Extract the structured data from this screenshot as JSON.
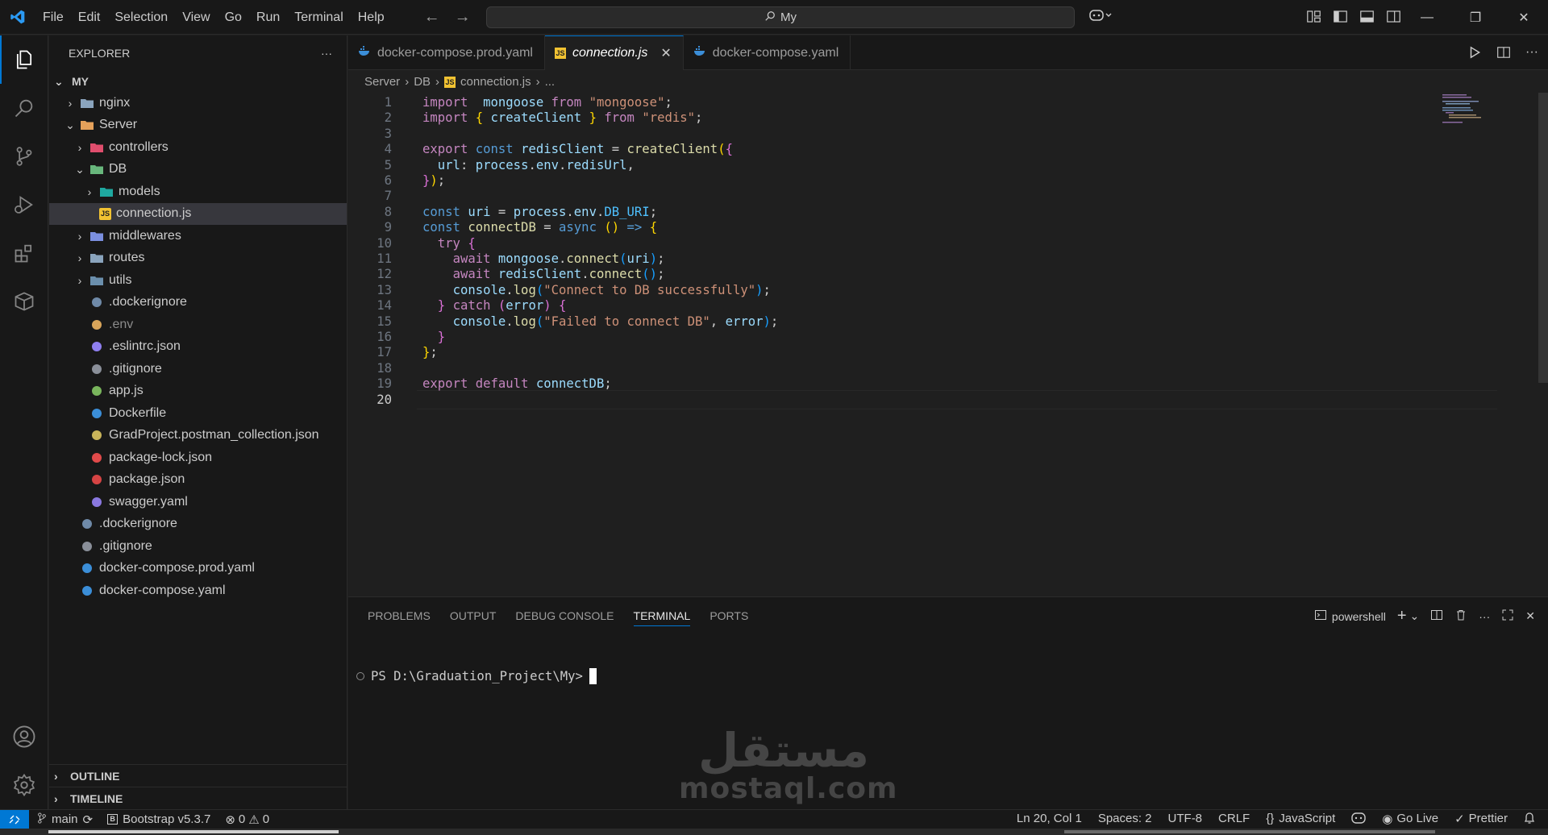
{
  "menu": [
    "File",
    "Edit",
    "Selection",
    "View",
    "Go",
    "Run",
    "Terminal",
    "Help"
  ],
  "search": {
    "text": "My"
  },
  "sidebar": {
    "title": "EXPLORER",
    "root": "MY",
    "tree": [
      {
        "label": "nginx",
        "depth": 1,
        "chev": "›",
        "icon": "folder-icon",
        "color": "#8aa4bd"
      },
      {
        "label": "Server",
        "depth": 1,
        "chev": "⌄",
        "icon": "folder-open-icon",
        "color": "#e5a15a"
      },
      {
        "label": "controllers",
        "depth": 2,
        "chev": "›",
        "icon": "folder-controllers-icon",
        "color": "#e04e6d"
      },
      {
        "label": "DB",
        "depth": 2,
        "chev": "⌄",
        "icon": "folder-db-icon",
        "color": "#68b77c"
      },
      {
        "label": "models",
        "depth": 3,
        "chev": "›",
        "icon": "folder-models-icon",
        "color": "#1fa9a0"
      },
      {
        "label": "connection.js",
        "depth": 3,
        "chev": "",
        "icon": "js-file-icon",
        "color": "#f1c232",
        "selected": true
      },
      {
        "label": "middlewares",
        "depth": 2,
        "chev": "›",
        "icon": "folder-middlewares-icon",
        "color": "#7b8fe0"
      },
      {
        "label": "routes",
        "depth": 2,
        "chev": "›",
        "icon": "folder-routes-icon",
        "color": "#8aa4bd"
      },
      {
        "label": "utils",
        "depth": 2,
        "chev": "›",
        "icon": "folder-utils-icon",
        "color": "#6b8fad"
      },
      {
        "label": ".dockerignore",
        "depth": 2,
        "chev": "",
        "icon": "docker-icon",
        "color": "#6f8aa8"
      },
      {
        "label": ".env",
        "depth": 2,
        "chev": "",
        "icon": "env-icon",
        "color": "#d9a55a",
        "dim": true
      },
      {
        "label": ".eslintrc.json",
        "depth": 2,
        "chev": "",
        "icon": "eslint-icon",
        "color": "#8f7ff0"
      },
      {
        "label": ".gitignore",
        "depth": 2,
        "chev": "",
        "icon": "git-icon",
        "color": "#8a8f99"
      },
      {
        "label": "app.js",
        "depth": 2,
        "chev": "",
        "icon": "nodejs-icon",
        "color": "#79b55c"
      },
      {
        "label": "Dockerfile",
        "depth": 2,
        "chev": "",
        "icon": "docker-icon",
        "color": "#3b8ed8"
      },
      {
        "label": "GradProject.postman_collection.json",
        "depth": 2,
        "chev": "",
        "icon": "json-icon",
        "color": "#c9b45a"
      },
      {
        "label": "package-lock.json",
        "depth": 2,
        "chev": "",
        "icon": "lock-icon",
        "color": "#e14a4a"
      },
      {
        "label": "package.json",
        "depth": 2,
        "chev": "",
        "icon": "npm-icon",
        "color": "#d64444"
      },
      {
        "label": "swagger.yaml",
        "depth": 2,
        "chev": "",
        "icon": "swagger-icon",
        "color": "#8a78e0"
      },
      {
        "label": ".dockerignore",
        "depth": 1,
        "chev": "",
        "icon": "docker-icon",
        "color": "#6f8aa8"
      },
      {
        "label": ".gitignore",
        "depth": 1,
        "chev": "",
        "icon": "git-icon",
        "color": "#8a8f99"
      },
      {
        "label": "docker-compose.prod.yaml",
        "depth": 1,
        "chev": "",
        "icon": "docker-icon",
        "color": "#3b8ed8"
      },
      {
        "label": "docker-compose.yaml",
        "depth": 1,
        "chev": "",
        "icon": "docker-icon",
        "color": "#3b8ed8"
      }
    ],
    "outline": "OUTLINE",
    "timeline": "TIMELINE"
  },
  "tabs": [
    {
      "label": "docker-compose.prod.yaml",
      "icon": "docker-icon",
      "active": false
    },
    {
      "label": "connection.js",
      "icon": "js-file-icon",
      "active": true
    },
    {
      "label": "docker-compose.yaml",
      "icon": "docker-icon",
      "active": false
    }
  ],
  "breadcrumb": {
    "seg1": "Server",
    "seg2": "DB",
    "seg3": "connection.js",
    "seg4": "..."
  },
  "code_lines": [
    {
      "n": "1",
      "t": [
        [
          "kw",
          "import"
        ],
        [
          "",
          "  "
        ],
        [
          "vr",
          "mongoose"
        ],
        [
          "",
          ""
        ],
        [
          "kw",
          " from "
        ],
        [
          "st",
          "\"mongoose\""
        ],
        [
          "",
          ";"
        ]
      ]
    },
    {
      "n": "2",
      "t": [
        [
          "kw",
          "import"
        ],
        [
          "",
          " "
        ],
        [
          "br1",
          "{"
        ],
        [
          "",
          " "
        ],
        [
          "vr",
          "createClient"
        ],
        [
          "",
          " "
        ],
        [
          "br1",
          "}"
        ],
        [
          "kw",
          " from "
        ],
        [
          "st",
          "\"redis\""
        ],
        [
          "",
          ";"
        ]
      ]
    },
    {
      "n": "3",
      "t": []
    },
    {
      "n": "4",
      "t": [
        [
          "kw",
          "export"
        ],
        [
          "",
          " "
        ],
        [
          "kw2",
          "const"
        ],
        [
          "",
          " "
        ],
        [
          "vr",
          "redisClient"
        ],
        [
          "",
          " = "
        ],
        [
          "fn",
          "createClient"
        ],
        [
          "br1",
          "("
        ],
        [
          "br2",
          "{"
        ]
      ]
    },
    {
      "n": "5",
      "t": [
        [
          "",
          "  "
        ],
        [
          "vr",
          "url"
        ],
        [
          "",
          ": "
        ],
        [
          "vr",
          "process"
        ],
        [
          "",
          "."
        ],
        [
          "vr",
          "env"
        ],
        [
          "",
          "."
        ],
        [
          "vr",
          "redisUrl"
        ],
        [
          "",
          ","
        ]
      ]
    },
    {
      "n": "6",
      "t": [
        [
          "br2",
          "}"
        ],
        [
          "br1",
          ")"
        ],
        [
          "",
          ";"
        ]
      ]
    },
    {
      "n": "7",
      "t": []
    },
    {
      "n": "8",
      "t": [
        [
          "kw2",
          "const"
        ],
        [
          "",
          " "
        ],
        [
          "vr",
          "uri"
        ],
        [
          "",
          " = "
        ],
        [
          "vr",
          "process"
        ],
        [
          "",
          "."
        ],
        [
          "vr",
          "env"
        ],
        [
          "",
          "."
        ],
        [
          "cn",
          "DB_URI"
        ],
        [
          "",
          ";"
        ]
      ]
    },
    {
      "n": "9",
      "t": [
        [
          "kw2",
          "const"
        ],
        [
          "",
          " "
        ],
        [
          "fn",
          "connectDB"
        ],
        [
          "",
          " = "
        ],
        [
          "kw2",
          "async"
        ],
        [
          "",
          " "
        ],
        [
          "br1",
          "()"
        ],
        [
          "",
          " "
        ],
        [
          "kw2",
          "=>"
        ],
        [
          "",
          " "
        ],
        [
          "br1",
          "{"
        ]
      ]
    },
    {
      "n": "10",
      "t": [
        [
          "",
          "  "
        ],
        [
          "kw",
          "try"
        ],
        [
          "",
          " "
        ],
        [
          "br2",
          "{"
        ]
      ]
    },
    {
      "n": "11",
      "t": [
        [
          "",
          "    "
        ],
        [
          "kw",
          "await"
        ],
        [
          "",
          " "
        ],
        [
          "vr",
          "mongoose"
        ],
        [
          "",
          "."
        ],
        [
          "fn",
          "connect"
        ],
        [
          "br3",
          "("
        ],
        [
          "vr",
          "uri"
        ],
        [
          "br3",
          ")"
        ],
        [
          "",
          ";"
        ]
      ]
    },
    {
      "n": "12",
      "t": [
        [
          "",
          "    "
        ],
        [
          "kw",
          "await"
        ],
        [
          "",
          " "
        ],
        [
          "vr",
          "redisClient"
        ],
        [
          "",
          "."
        ],
        [
          "fn",
          "connect"
        ],
        [
          "br3",
          "()"
        ],
        [
          "",
          ";"
        ]
      ]
    },
    {
      "n": "13",
      "t": [
        [
          "",
          "    "
        ],
        [
          "vr",
          "console"
        ],
        [
          "",
          "."
        ],
        [
          "fn",
          "log"
        ],
        [
          "br3",
          "("
        ],
        [
          "st",
          "\"Connect to DB successfully\""
        ],
        [
          "br3",
          ")"
        ],
        [
          "",
          ";"
        ]
      ]
    },
    {
      "n": "14",
      "t": [
        [
          "",
          "  "
        ],
        [
          "br2",
          "}"
        ],
        [
          "",
          " "
        ],
        [
          "kw",
          "catch"
        ],
        [
          "",
          " "
        ],
        [
          "br2",
          "("
        ],
        [
          "vr",
          "error"
        ],
        [
          "br2",
          ")"
        ],
        [
          "",
          " "
        ],
        [
          "br2",
          "{"
        ]
      ]
    },
    {
      "n": "15",
      "t": [
        [
          "",
          "    "
        ],
        [
          "vr",
          "console"
        ],
        [
          "",
          "."
        ],
        [
          "fn",
          "log"
        ],
        [
          "br3",
          "("
        ],
        [
          "st",
          "\"Failed to connect DB\""
        ],
        [
          "",
          ", "
        ],
        [
          "vr",
          "error"
        ],
        [
          "br3",
          ")"
        ],
        [
          "",
          ";"
        ]
      ]
    },
    {
      "n": "16",
      "t": [
        [
          "",
          "  "
        ],
        [
          "br2",
          "}"
        ]
      ]
    },
    {
      "n": "17",
      "t": [
        [
          "br1",
          "}"
        ],
        [
          "",
          ";"
        ]
      ]
    },
    {
      "n": "18",
      "t": []
    },
    {
      "n": "19",
      "t": [
        [
          "kw",
          "export"
        ],
        [
          "",
          " "
        ],
        [
          "kw",
          "default"
        ],
        [
          "",
          " "
        ],
        [
          "vr",
          "connectDB"
        ],
        [
          "",
          ";"
        ]
      ]
    },
    {
      "n": "20",
      "t": [],
      "current": true
    }
  ],
  "panel": {
    "tabs": [
      "PROBLEMS",
      "OUTPUT",
      "DEBUG CONSOLE",
      "TERMINAL",
      "PORTS"
    ],
    "active_tab": "TERMINAL",
    "shell": "powershell",
    "prompt": "PS D:\\Graduation_Project\\My>"
  },
  "watermark": {
    "arabic": "مستقل",
    "latin": "mostaql.com"
  },
  "status": {
    "branch": "main",
    "bootstrap": "Bootstrap v5.3.7",
    "errors": "0",
    "warnings": "0",
    "position": "Ln 20, Col 1",
    "spaces": "Spaces: 2",
    "encoding": "UTF-8",
    "eol": "CRLF",
    "language": "JavaScript",
    "golive": "Go Live",
    "prettier": "Prettier"
  }
}
